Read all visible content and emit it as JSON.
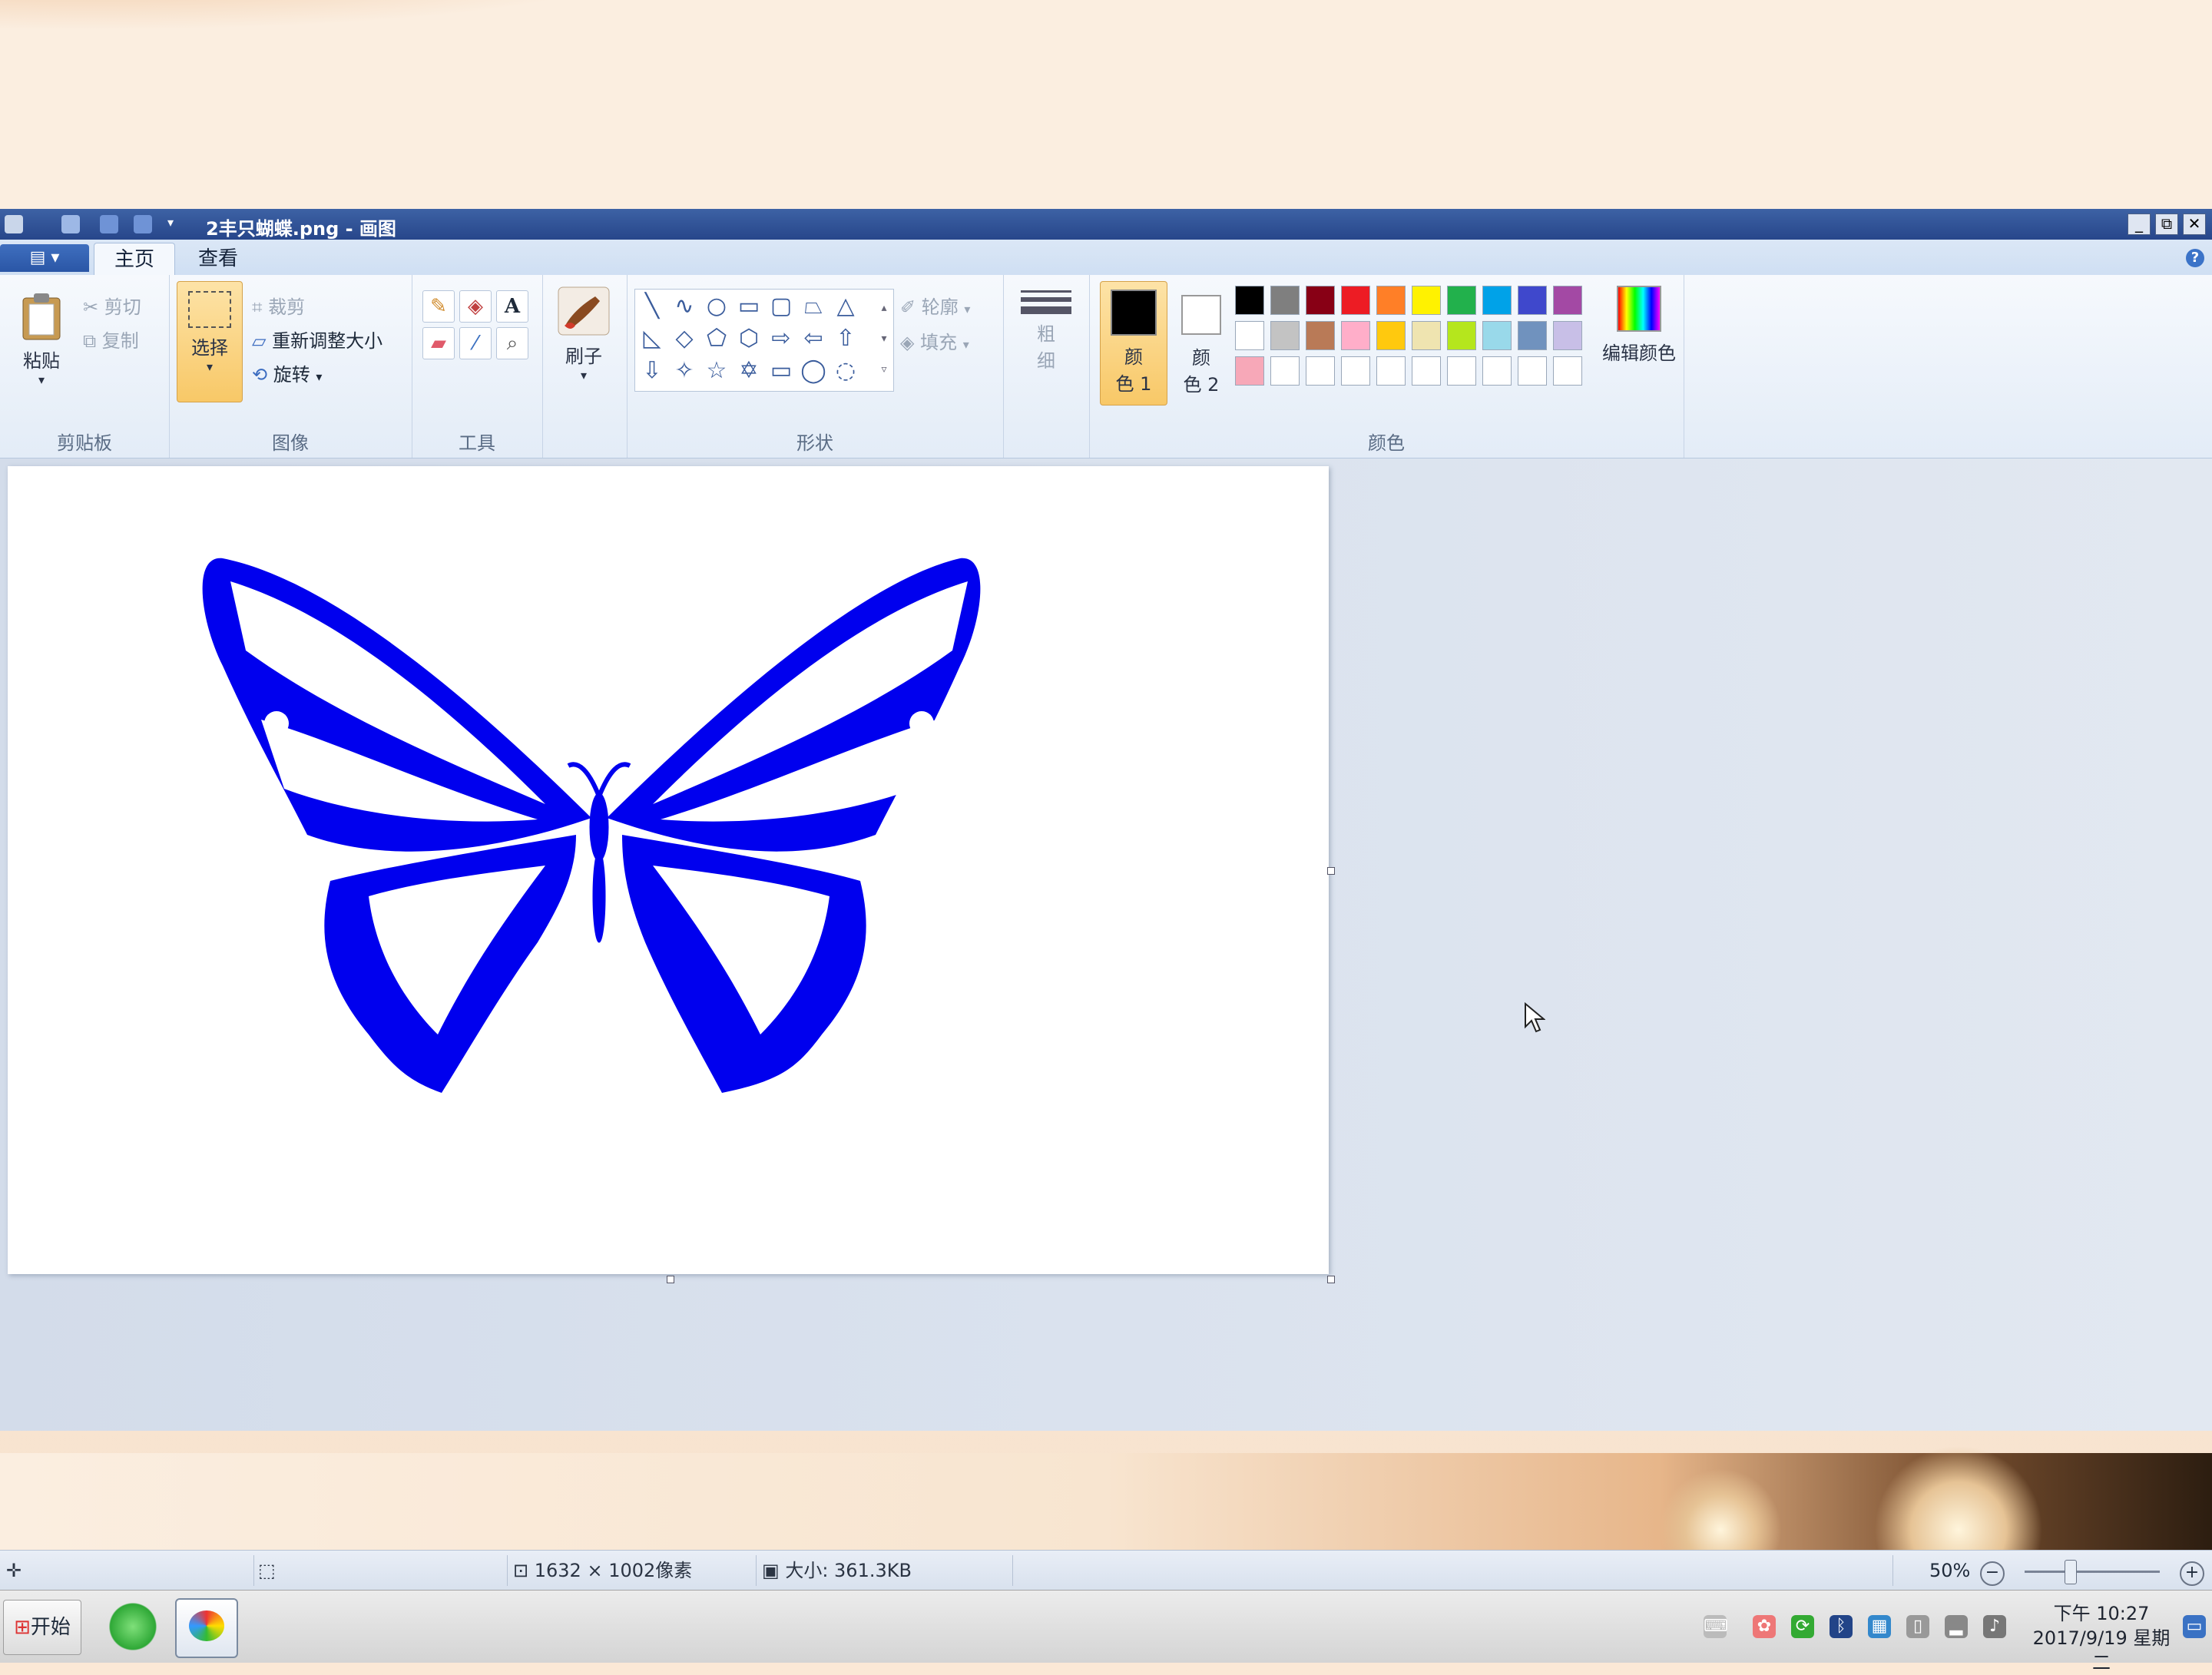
{
  "window": {
    "title": "2丰只蝴蝶.png - 画图",
    "controls": [
      "_",
      "⧉",
      "✕"
    ]
  },
  "tabs": [
    {
      "label": "主页",
      "active": true
    },
    {
      "label": "查看",
      "active": false
    }
  ],
  "app_menu_label": "▤ ▾",
  "help_label": "?",
  "ribbon": {
    "clipboard": {
      "group_label": "剪贴板",
      "paste": "粘贴",
      "cut": "剪切",
      "copy": "复制"
    },
    "image": {
      "group_label": "图像",
      "select": "选择",
      "crop": "裁剪",
      "resize": "重新调整大小",
      "rotate": "旋转"
    },
    "tools": {
      "group_label": "工具"
    },
    "brushes": {
      "label": "刷子"
    },
    "shapes": {
      "group_label": "形状",
      "outline": "轮廓",
      "fill": "填充"
    },
    "size": {
      "label_line1": "粗",
      "label_line2": "细"
    },
    "colors": {
      "group_label": "颜色",
      "color1": "颜\n色 1",
      "color1_a": "颜",
      "color1_b": "色 1",
      "color2_a": "颜",
      "color2_b": "色 2",
      "edit_colors": "编辑颜色",
      "color1_value": "#000000",
      "color2_value": "#ffffff",
      "palette_row1": [
        "#000000",
        "#7f7f7f",
        "#880015",
        "#ed1c24",
        "#ff7f27",
        "#fff200",
        "#22b14c",
        "#00a2e8",
        "#3f48cc",
        "#a349a4"
      ],
      "palette_row2": [
        "#ffffff",
        "#c3c3c3",
        "#b97a57",
        "#ffaec9",
        "#ffc90e",
        "#efe4b0",
        "#b5e61d",
        "#99d9ea",
        "#7092be",
        "#c8bfe7"
      ],
      "palette_row3": [
        "#f7a8b8",
        "#ffffff",
        "#ffffff",
        "#ffffff",
        "#ffffff",
        "#ffffff",
        "#ffffff",
        "#ffffff",
        "#ffffff",
        "#ffffff"
      ]
    }
  },
  "canvas": {
    "image_color": "#0000ee"
  },
  "statusbar": {
    "cursor_pos": "",
    "selection_size": "",
    "image_dimensions": "1632 × 1002像素",
    "file_size": "大小: 361.3KB",
    "zoom": "50%",
    "zoom_fraction": 0.5
  },
  "taskbar": {
    "start_label": "开始",
    "clock_time": "下午 10:27",
    "clock_date": "2017/9/19 星期二"
  }
}
